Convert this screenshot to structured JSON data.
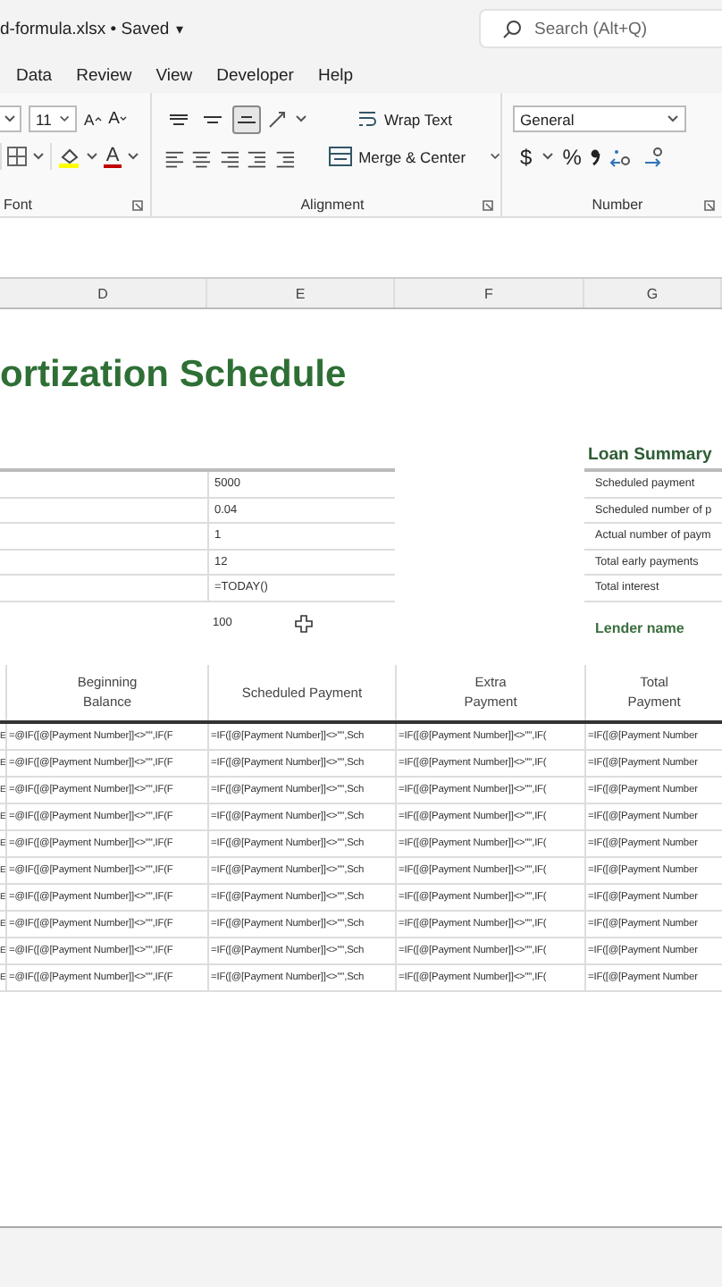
{
  "title_bar": {
    "file_name": "d-formula.xlsx • Saved",
    "caret": "▾",
    "search": {
      "placeholder": "Search (Alt+Q)"
    }
  },
  "menu_tabs": [
    {
      "label": "Data",
      "selected": false
    },
    {
      "label": "Review",
      "selected": false
    },
    {
      "label": "View",
      "selected": false
    },
    {
      "label": "Developer",
      "selected": false
    },
    {
      "label": "Help",
      "selected": false
    }
  ],
  "ribbon": {
    "font_size": "11",
    "grow_font": "A",
    "shrink_font": "A",
    "font_color": "A",
    "align_buttons": [
      {
        "kind": "top",
        "selected": false
      },
      {
        "kind": "middle",
        "selected": false
      },
      {
        "kind": "bottom",
        "selected": true
      }
    ],
    "wrap_text": "Wrap Text",
    "merge_center": "Merge & Center",
    "number_format": "General",
    "currency": "$",
    "percent": "%",
    "groups": [
      "Font",
      "Alignment",
      "Number"
    ]
  },
  "sheet": {
    "columns": [
      "D",
      "E",
      "F",
      "G"
    ],
    "title": "ortization Schedule",
    "inputs": [
      "5000",
      "0.04",
      "1",
      "12",
      "=TODAY()"
    ],
    "extra_value": "100",
    "loan_summary": {
      "title": "Loan Summary",
      "items": [
        "Scheduled payment",
        "Scheduled number of p",
        "Actual number of paym",
        "Total early payments",
        "Total interest"
      ],
      "lender": "Lender name"
    },
    "table": {
      "headers": [
        "Beginning Balance",
        "Scheduled Payment",
        "Extra Payment",
        "Total Payment"
      ],
      "rows": [
        [
          "E",
          "=@IF([@[Payment Number]]<>\"\",IF(F",
          "=IF([@[Payment Number]]<>\"\",Sch",
          "=IF([@[Payment Number]]<>\"\",IF(",
          "=IF([@[Payment Number"
        ],
        [
          "E",
          "=@IF([@[Payment Number]]<>\"\",IF(F",
          "=IF([@[Payment Number]]<>\"\",Sch",
          "=IF([@[Payment Number]]<>\"\",IF(",
          "=IF([@[Payment Number"
        ],
        [
          "E",
          "=@IF([@[Payment Number]]<>\"\",IF(F",
          "=IF([@[Payment Number]]<>\"\",Sch",
          "=IF([@[Payment Number]]<>\"\",IF(",
          "=IF([@[Payment Number"
        ],
        [
          "E",
          "=@IF([@[Payment Number]]<>\"\",IF(F",
          "=IF([@[Payment Number]]<>\"\",Sch",
          "=IF([@[Payment Number]]<>\"\",IF(",
          "=IF([@[Payment Number"
        ],
        [
          "E",
          "=@IF([@[Payment Number]]<>\"\",IF(F",
          "=IF([@[Payment Number]]<>\"\",Sch",
          "=IF([@[Payment Number]]<>\"\",IF(",
          "=IF([@[Payment Number"
        ],
        [
          "E",
          "=@IF([@[Payment Number]]<>\"\",IF(F",
          "=IF([@[Payment Number]]<>\"\",Sch",
          "=IF([@[Payment Number]]<>\"\",IF(",
          "=IF([@[Payment Number"
        ],
        [
          "E",
          "=@IF([@[Payment Number]]<>\"\",IF(F",
          "=IF([@[Payment Number]]<>\"\",Sch",
          "=IF([@[Payment Number]]<>\"\",IF(",
          "=IF([@[Payment Number"
        ],
        [
          "E",
          "=@IF([@[Payment Number]]<>\"\",IF(F",
          "=IF([@[Payment Number]]<>\"\",Sch",
          "=IF([@[Payment Number]]<>\"\",IF(",
          "=IF([@[Payment Number"
        ],
        [
          "E",
          "=@IF([@[Payment Number]]<>\"\",IF(F",
          "=IF([@[Payment Number]]<>\"\",Sch",
          "=IF([@[Payment Number]]<>\"\",IF(",
          "=IF([@[Payment Number"
        ],
        [
          "E",
          "=@IF([@[Payment Number]]<>\"\",IF(F",
          "=IF([@[Payment Number]]<>\"\",Sch",
          "=IF([@[Payment Number]]<>\"\",IF(",
          "=IF([@[Payment Number"
        ]
      ]
    }
  }
}
